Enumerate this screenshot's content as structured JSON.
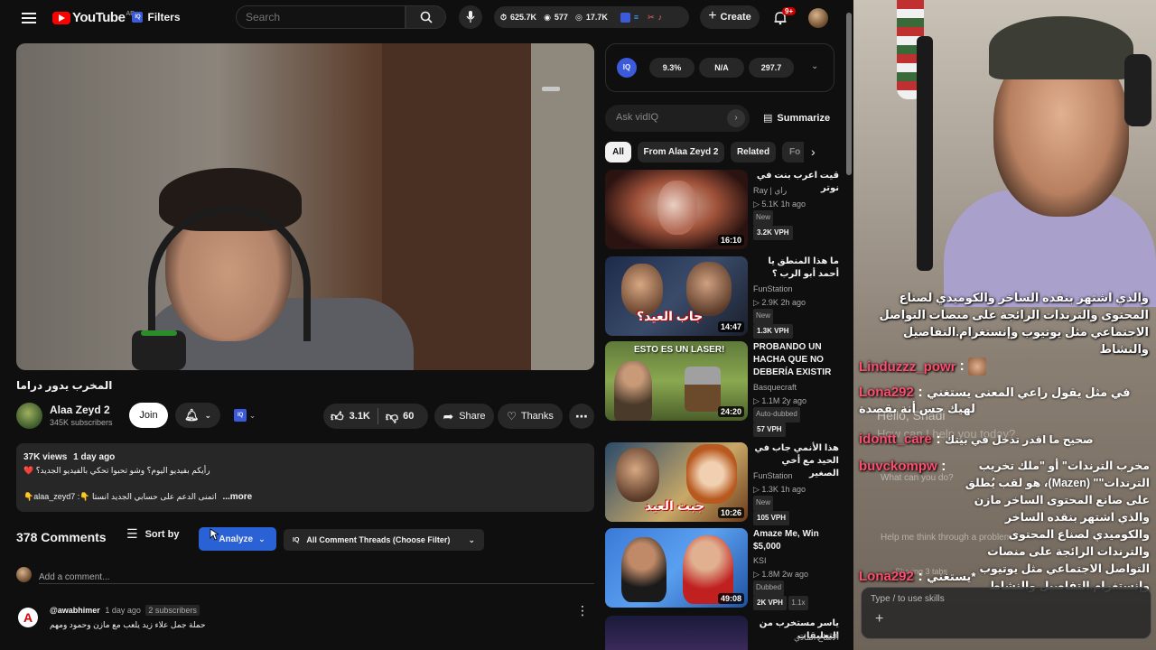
{
  "header": {
    "logo_text": "YouTube",
    "logo_region": "AE",
    "filters_label": "Filters",
    "search_placeholder": "Search",
    "stats": {
      "views": "625.7K",
      "likes": "577",
      "subs": "17.7K"
    },
    "create_label": "Create",
    "notifications_count": "9+"
  },
  "video": {
    "title": "المخرب يدور دراما",
    "channel": "Alaa Zeyd 2",
    "subscribers": "345K subscribers",
    "join_label": "Join",
    "likes": "3.1K",
    "dislikes": "60",
    "share_label": "Share",
    "thanks_label": "Thanks"
  },
  "description": {
    "views": "37K views",
    "age": "1 day ago",
    "line1": "رأيكم بفيديو اليوم؟ وشو تحبوا تحكي بالفيديو الجديد؟ ❤️",
    "line2": "اتمنى الدعم على حسابي الجديد انستا 👇: alaa_zeyd7👇",
    "more_label": "...more"
  },
  "comments": {
    "count_label": "378 Comments",
    "sort_label": "Sort by",
    "analyze_label": "Analyze",
    "threads_label": "All Comment Threads (Choose Filter)",
    "add_placeholder": "Add a comment...",
    "first": {
      "author": "@awabhimer",
      "age": "1 day ago",
      "subs_badge": "2 subscribers",
      "text": "حملة جمل علاء زيد يلعب مع مازن وحمود ومهم"
    }
  },
  "vidiq": {
    "stat1": "9.3%",
    "stat2": "N/A",
    "stat3": "297.7",
    "ask_placeholder": "Ask vidIQ",
    "summarize_label": "Summarize"
  },
  "chips": [
    "All",
    "From Alaa Zeyd 2",
    "Related",
    "Fo"
  ],
  "related": [
    {
      "title": "قيت اعرب بنت في نوتر",
      "channel": "Ray | راي",
      "views": "▷ 5.1K",
      "age": "1h ago",
      "badge": "New",
      "vph": "3.2K VPH",
      "duration": "16:10"
    },
    {
      "title": "ما هذا المنطق يا أحمد أبو الرب ؟",
      "channel": "FunStation",
      "views": "▷ 2.9K",
      "age": "2h ago",
      "badge": "New",
      "vph": "1.3K VPH",
      "duration": "14:47"
    },
    {
      "title": "PROBANDO UN HACHA QUE NO DEBERÍA EXISTIR",
      "channel": "Basquecraft",
      "views": "▷ 1.1M",
      "age": "2y ago",
      "badge": "Auto-dubbed",
      "vph": "57 VPH",
      "duration": "24:20"
    },
    {
      "title": "هذا الأنمي جاب في الحيد مع أخي الصغير",
      "channel": "FunStation",
      "views": "▷ 1.3K",
      "age": "1h ago",
      "badge": "New",
      "vph": "105 VPH",
      "duration": "10:26"
    },
    {
      "title": "Amaze Me, Win $5,000",
      "channel": "KSI",
      "views": "▷ 1.8M",
      "age": "2w ago",
      "badge": "Dubbed",
      "vph": "2K VPH",
      "extra": "1.1x",
      "duration": "49:08"
    },
    {
      "title": "ياسر مستخرب من التعليقات",
      "channel": "الاشاع المادي",
      "views": "",
      "age": "",
      "badge": "",
      "vph": "",
      "duration": ""
    }
  ],
  "thumb_text": {
    "t2": "جاب العيد؟",
    "t3": "ESTO ES UN LASER!",
    "t4": "جبت العيد"
  },
  "stream": {
    "chat": [
      {
        "text": "والذي اشتهر بنقده الساخر والكوميدي لصناع المحتوى والترندات الرائجة على منصات التواصل الاجتماعي مثل يوتيوب وإنستغرام.التفاصيل والنشاط"
      },
      {
        "name": "Linduzzz_powr",
        "text": ""
      },
      {
        "name": "Lona292",
        "text": "في مثل يقول راعي المعنى يستغني لهيك حس أنة بقصدة"
      },
      {
        "name": "idontt_care",
        "text": "صحيح ما اقدر تدخل في بيتك"
      },
      {
        "name": "buvckompw",
        "text": "مخرب الترندات\" أو \"ملك تخريب الترندات\"\" (Mazen)، هو لقب يُطلق على صانع المحتوى الساخر مازن والذي اشتهر بنقده الساخر والكوميدي لصناع المحتوى والترندات الرائجة على منصات التواصل الاجتماعي مثل يوتيوب وإنستغرام.التفاصيل والنشاط"
      },
      {
        "name": "Lona292",
        "text": "يستغني*"
      }
    ],
    "ghost": [
      "Hello, Shadi",
      "How can I help you today?",
      "What can you do?",
      "Help me think through a problem",
      "Sharing 3 tabs"
    ],
    "input_placeholder": "Type / to use skills",
    "plus_label": "+"
  },
  "colors": {
    "accent": "#3ea6ff",
    "youtube_red": "#ff0000",
    "analyze_blue": "#2a62d6",
    "bg": "#0f0f0f"
  }
}
